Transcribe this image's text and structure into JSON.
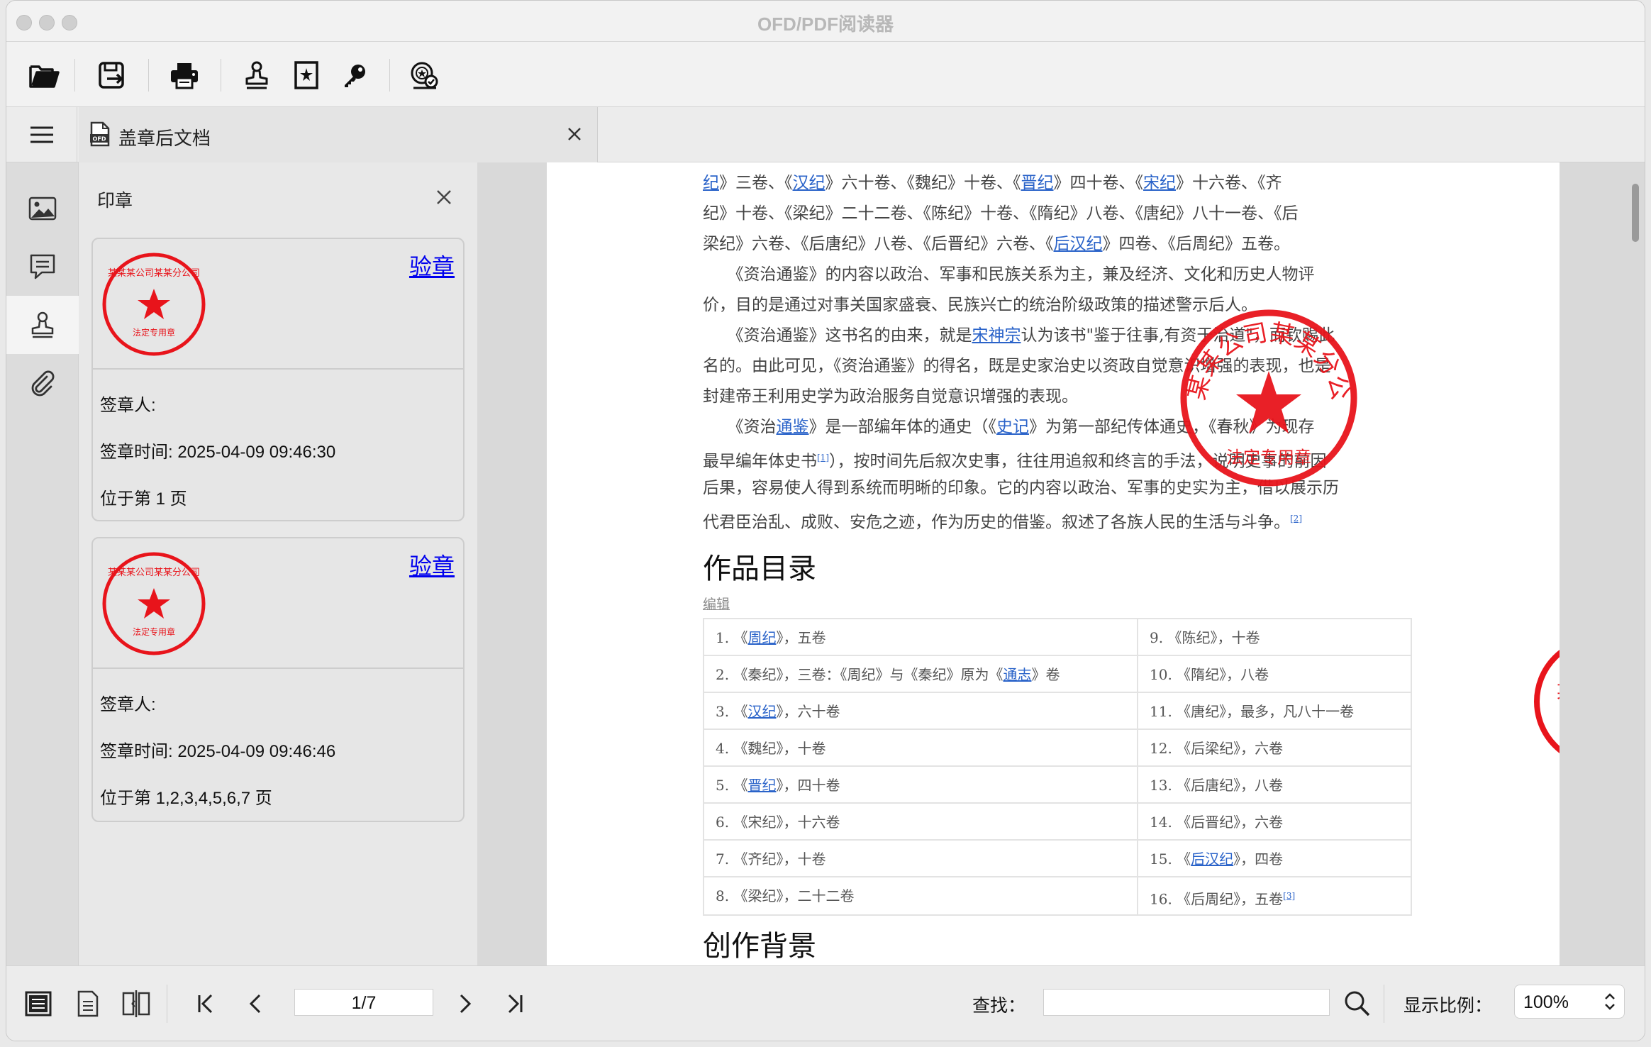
{
  "window": {
    "title": "OFD/PDF阅读器"
  },
  "toolbar": {
    "icons": [
      "open-folder-icon",
      "save-icon",
      "print-icon",
      "stamp-icon",
      "seal-box-icon",
      "key-icon",
      "verify-seal-icon"
    ]
  },
  "tab": {
    "label": "盖章后文档",
    "icon": "ofd-file-icon"
  },
  "sidebar": {
    "icons": [
      "thumbnail-icon",
      "comment-icon",
      "seal-icon",
      "attachment-icon"
    ],
    "active": "seal-icon"
  },
  "seal_panel": {
    "title": "印章",
    "cards": [
      {
        "verify_label": "验章",
        "signer": "签章人:",
        "time": "签章时间: 2025-04-09 09:46:30",
        "pages": "位于第 1 页"
      },
      {
        "verify_label": "验章",
        "signer": "签章人:",
        "time": "签章时间: 2025-04-09 09:46:46",
        "pages": "位于第 1,2,3,4,5,6,7 页"
      }
    ]
  },
  "document": {
    "lines": [
      {
        "a": "",
        "l": "纪",
        "b": "》三卷、《",
        "l2": "汉纪",
        "c": "》六十卷、《魏纪》十卷、《",
        "l3": "晋纪",
        "d": "》四十卷、《",
        "l4": "宋纪",
        "e": "》十六卷、《齐"
      },
      {
        "a": "纪》十卷、《梁纪》二十二卷、《陈纪》十卷、《隋纪》八卷、《唐纪》八十一卷、《后"
      },
      {
        "a": "梁纪》六卷、《后唐纪》八卷、《后晋纪》六卷、《",
        "l": "后汉纪",
        "b": "》四卷、《后周纪》五卷。"
      },
      {
        "a": "　　《资治通鉴》的内容以政治、军事和民族关系为主，兼及经济、文化和历史人物评"
      },
      {
        "a": "价，目的是通过对事关国家盛衰、民族兴亡的统治阶级政策的描述警示后人。"
      },
      {
        "a": "　　《资治通鉴》这书名的由来，就是",
        "l": "宋神宗",
        "b": "认为该书\"鉴于往事,有资于治道\"，而钦赐此"
      },
      {
        "a": "名的。由此可见，《资治通鉴》的得名，既是史家治史以资政自觉意识增强的表现，也是"
      },
      {
        "a": "封建帝王利用史学为政治服务自觉意识增强的表现。"
      },
      {
        "a": "　　《资治",
        "l": "通鉴",
        "b": "》是一部编年体的通史（《",
        "l2": "史记",
        "c": "》为第一部纪传体通史，《春秋》为现存"
      },
      {
        "a": "最早编年体史书",
        "sup": "[1]",
        "b": "），按时间先后叙次史事，往往用追叙和终言的手法，说明史事的前因"
      },
      {
        "a": "后果，容易使人得到系统而明晰的印象。它的内容以政治、军事的史实为主，借以展示历"
      },
      {
        "a": "代君臣治乱、成败、安危之迹，作为历史的借鉴。叙述了各族人民的生活与斗争。",
        "sup": "[2]"
      }
    ],
    "heading1": "作品目录",
    "edit_label": "编辑",
    "table": [
      {
        "left": {
          "a": "1.  《",
          "l": "周纪",
          "b": "》，五卷"
        },
        "right": {
          "a": "9.  《陈纪》，十卷"
        }
      },
      {
        "left": {
          "a": "2.  《秦纪》，三卷：《周纪》与《秦纪》原为《",
          "l": "通志",
          "b": "》卷"
        },
        "right": {
          "a": "10.  《隋纪》，八卷"
        }
      },
      {
        "left": {
          "a": "3.  《",
          "l": "汉纪",
          "b": "》，六十卷"
        },
        "right": {
          "a": "11.  《唐纪》，最多，凡八十一卷"
        }
      },
      {
        "left": {
          "a": "4.  《魏纪》，十卷"
        },
        "right": {
          "a": "12.  《后梁纪》，六卷"
        }
      },
      {
        "left": {
          "a": "5.  《",
          "l": "晋纪",
          "b": "》，四十卷"
        },
        "right": {
          "a": "13.  《后唐纪》，八卷"
        }
      },
      {
        "left": {
          "a": "6.  《宋纪》，十六卷"
        },
        "right": {
          "a": "14.  《后晋纪》，六卷"
        }
      },
      {
        "left": {
          "a": "7.  《齐纪》，十卷"
        },
        "right": {
          "a": "15.  《",
          "l": "后汉纪",
          "b": "》，四卷"
        }
      },
      {
        "left": {
          "a": "8.  《梁纪》，二十二卷"
        },
        "right": {
          "a": "16.  《后周纪》，五卷",
          "sup": "[3]"
        }
      }
    ],
    "heading2": "创作背景",
    "seal": {
      "top_text": "某某某某公司某某分公司",
      "bottom_text": "法定专用章",
      "color": "#e8141b"
    }
  },
  "statusbar": {
    "page_value": "1/7",
    "find_label": "查找：",
    "find_value": "",
    "zoom_label": "显示比例：",
    "zoom_value": "100%"
  }
}
